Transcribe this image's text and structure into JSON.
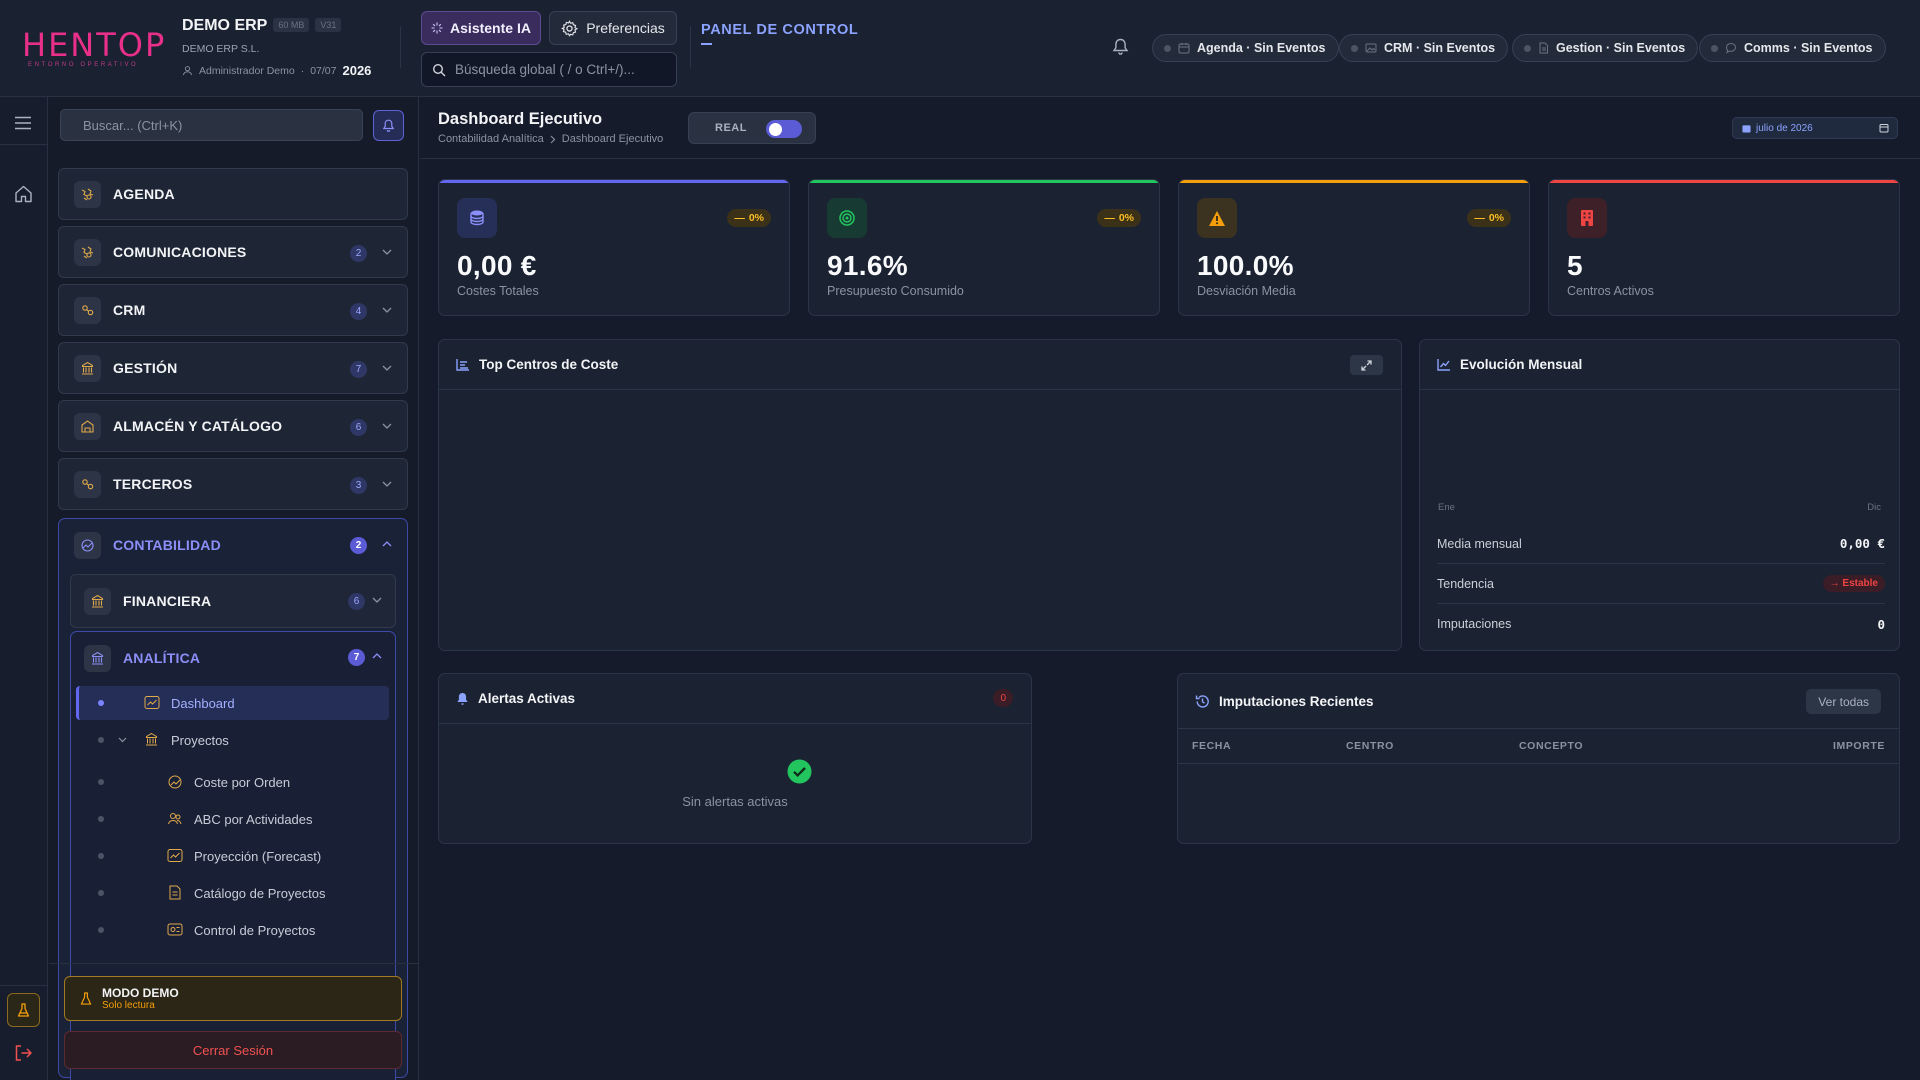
{
  "brand": {
    "logo": "HENTOP",
    "tagline": "ENTORNO OPERATIVO"
  },
  "header": {
    "app_name": "DEMO ERP",
    "size_badge": "60 MB",
    "version_badge": "V31",
    "company": "DEMO ERP S.L.",
    "user": "Administrador Demo",
    "date": "07/07",
    "year": "2026",
    "ai_button": "Asistente IA",
    "prefs_button": "Preferencias",
    "search_placeholder": "Búsqueda global ( / o Ctrl+/)...",
    "panel_title": "PANEL DE CONTROL",
    "chips": [
      {
        "label": "Agenda · Sin Eventos",
        "icon": "calendar-icon"
      },
      {
        "label": "CRM · Sin Eventos",
        "icon": "image-icon"
      },
      {
        "label": "Gestion · Sin Eventos",
        "icon": "document-icon"
      },
      {
        "label": "Comms · Sin Eventos",
        "icon": "chat-icon"
      }
    ]
  },
  "sidebar": {
    "search_placeholder": "Buscar... (Ctrl+K)",
    "modules": [
      {
        "label": "AGENDA",
        "badge": ""
      },
      {
        "label": "COMUNICACIONES",
        "badge": "2"
      },
      {
        "label": "CRM",
        "badge": "4"
      },
      {
        "label": "GESTIÓN",
        "badge": "7"
      },
      {
        "label": "ALMACÉN Y CATÁLOGO",
        "badge": "6"
      },
      {
        "label": "TERCEROS",
        "badge": "3"
      }
    ],
    "contabilidad": {
      "label": "CONTABILIDAD",
      "badge": "2"
    },
    "financiera": {
      "label": "FINANCIERA",
      "badge": "6"
    },
    "analitica": {
      "label": "ANALÍTICA",
      "badge": "7"
    },
    "leaves": [
      {
        "label": "Dashboard",
        "active": true
      },
      {
        "label": "Proyectos"
      },
      {
        "label": "Coste por Orden"
      },
      {
        "label": "ABC por Actividades"
      },
      {
        "label": "Proyección (Forecast)"
      },
      {
        "label": "Catálogo de Proyectos"
      },
      {
        "label": "Control de Proyectos"
      }
    ],
    "demo_title": "MODO DEMO",
    "demo_sub": "Solo lectura",
    "logout": "Cerrar Sesión"
  },
  "dashboard": {
    "title": "Dashboard Ejecutivo",
    "breadcrumb": [
      "Contabilidad Analítica",
      "Dashboard Ejecutivo"
    ],
    "mode_label": "REAL",
    "mode_on": true,
    "period": "julio de 2026",
    "kpis": [
      {
        "value": "0,00 €",
        "label": "Costes Totales",
        "delta": "0%",
        "color": "#6366f1",
        "icon": "coins-icon"
      },
      {
        "value": "91.6%",
        "label": "Presupuesto Consumido",
        "delta": "0%",
        "color": "#22c55e",
        "icon": "target-icon"
      },
      {
        "value": "100.0%",
        "label": "Desviación Media",
        "delta": "0%",
        "color": "#f59e0b",
        "icon": "warning-icon"
      },
      {
        "value": "5",
        "label": "Centros Activos",
        "delta": "",
        "color": "#ef4444",
        "icon": "building-icon"
      }
    ],
    "top_centros": {
      "title": "Top Centros de Coste"
    },
    "evolucion": {
      "title": "Evolución Mensual",
      "axis_start": "Ene",
      "axis_end": "Dic",
      "stats": [
        {
          "label": "Media mensual",
          "value": "0,00 €"
        },
        {
          "label": "Tendencia",
          "value": "Estable"
        },
        {
          "label": "Imputaciones",
          "value": "0"
        }
      ]
    },
    "alertas": {
      "title": "Alertas Activas",
      "count": "0",
      "empty": "Sin alertas activas"
    },
    "imputaciones": {
      "title": "Imputaciones Recientes",
      "view_all": "Ver todas",
      "columns": [
        "FECHA",
        "CENTRO",
        "CONCEPTO",
        "IMPORTE"
      ]
    }
  },
  "colors": {
    "accent": "#6366f1",
    "brand": "#e8308a",
    "danger": "#ef4444",
    "warning": "#f59e0b",
    "success": "#22c55e"
  }
}
